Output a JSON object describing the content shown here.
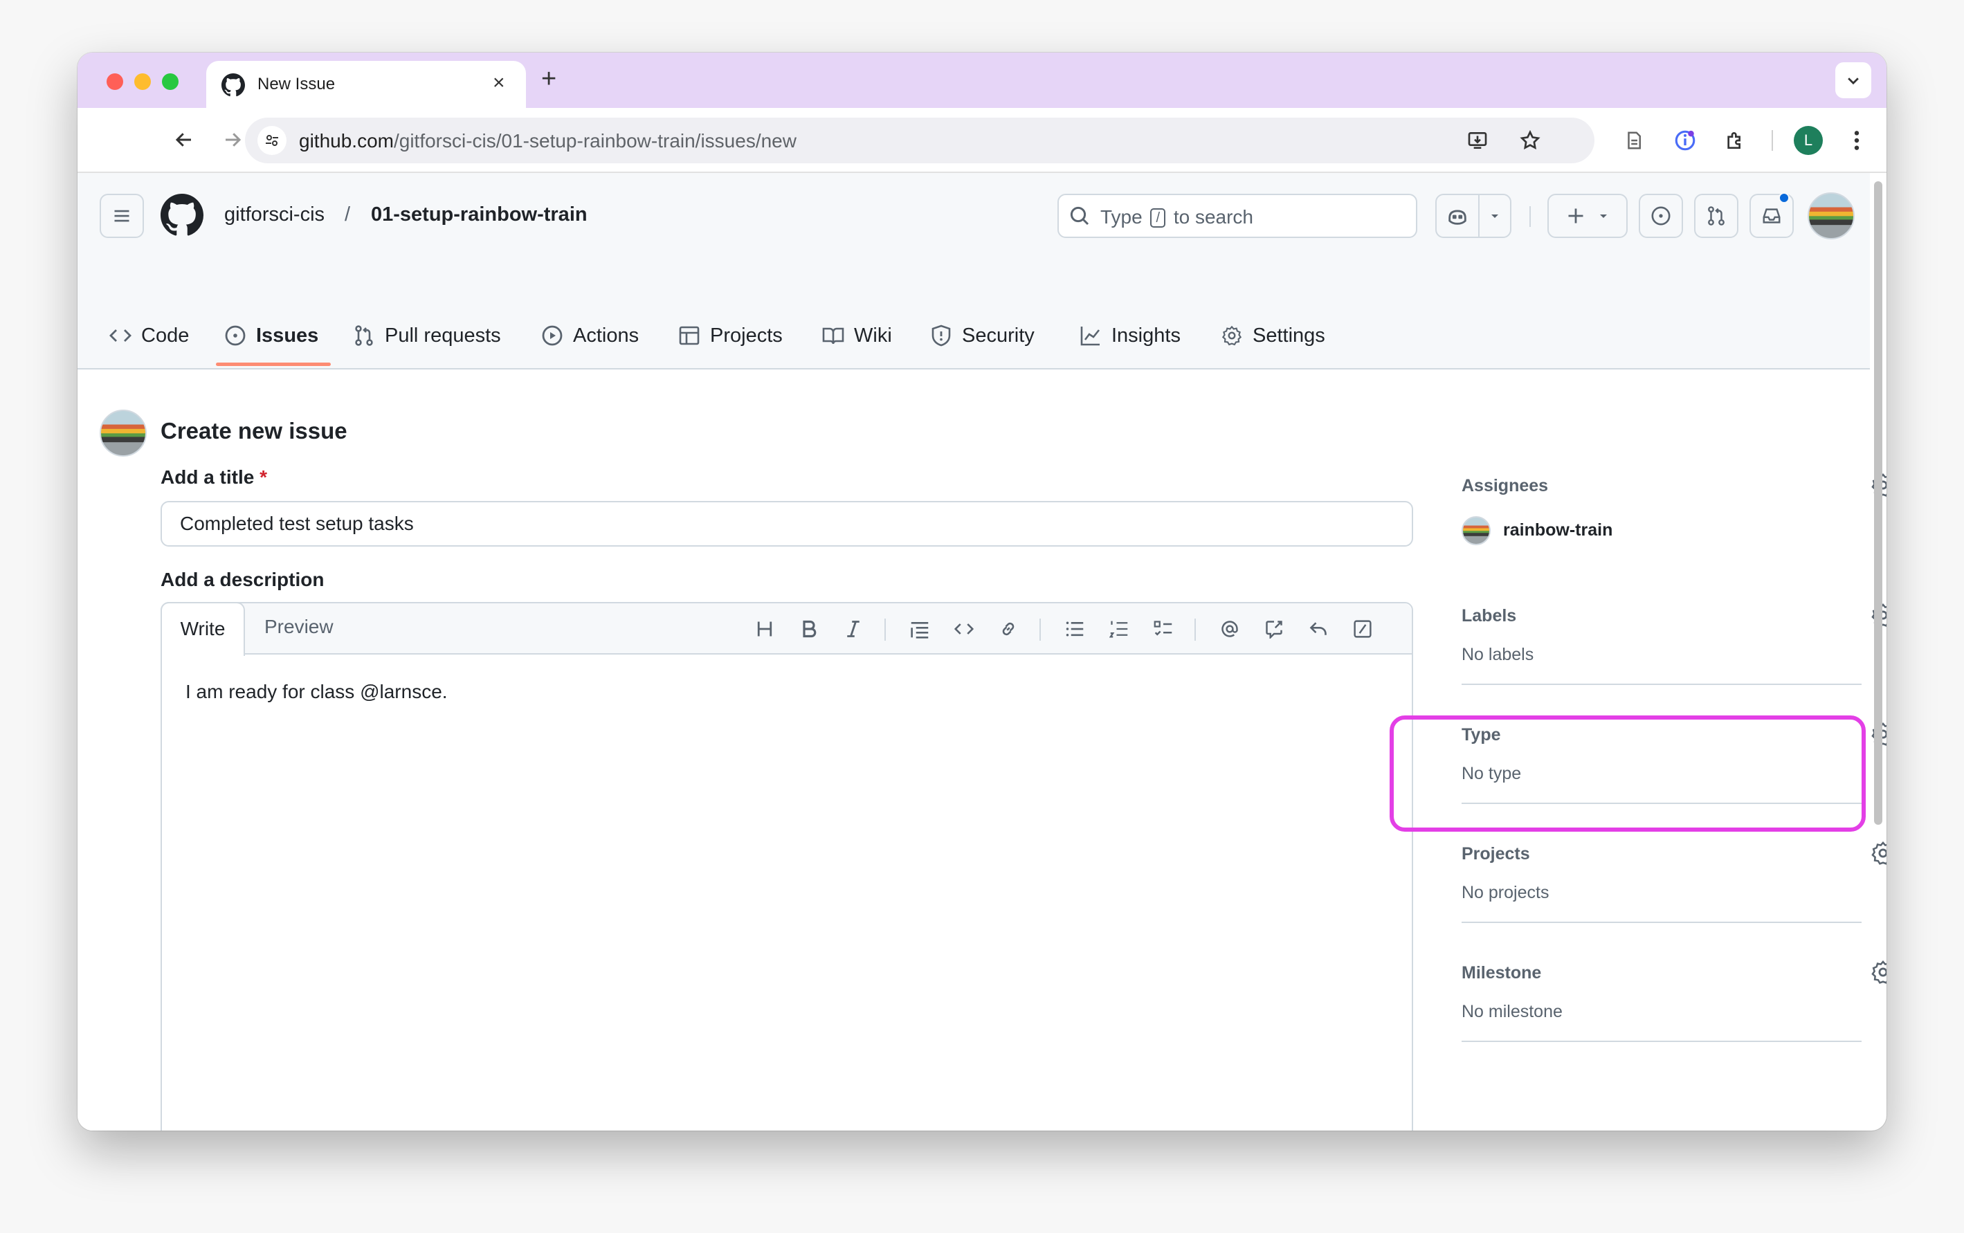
{
  "browser": {
    "tab_title": "New Issue",
    "new_tab_symbol": "+",
    "close_symbol": "×",
    "url_host": "github.com",
    "url_path": "/gitforsci-cis/01-setup-rainbow-train/issues/new",
    "profile_initial": "L"
  },
  "header": {
    "owner": "gitforsci-cis",
    "separator": "/",
    "repo": "01-setup-rainbow-train",
    "search_prefix": "Type",
    "search_key": "/",
    "search_suffix": "to search"
  },
  "repo_nav": [
    {
      "label": "Code",
      "icon": "code-icon"
    },
    {
      "label": "Issues",
      "icon": "issue-opened-icon",
      "active": true
    },
    {
      "label": "Pull requests",
      "icon": "git-pull-request-icon"
    },
    {
      "label": "Actions",
      "icon": "play-icon"
    },
    {
      "label": "Projects",
      "icon": "table-icon"
    },
    {
      "label": "Wiki",
      "icon": "book-icon"
    },
    {
      "label": "Security",
      "icon": "shield-icon"
    },
    {
      "label": "Insights",
      "icon": "graph-icon"
    },
    {
      "label": "Settings",
      "icon": "gear-icon"
    }
  ],
  "form": {
    "page_title": "Create new issue",
    "title_label": "Add a title",
    "required_mark": "*",
    "title_value": "Completed test setup tasks",
    "description_label": "Add a description",
    "write_tab": "Write",
    "preview_tab": "Preview",
    "description_value": "I am ready for class @larnsce."
  },
  "sidebar": {
    "assignees": {
      "title": "Assignees",
      "value": "rainbow-train"
    },
    "labels": {
      "title": "Labels",
      "value": "No labels"
    },
    "type": {
      "title": "Type",
      "value": "No type"
    },
    "projects": {
      "title": "Projects",
      "value": "No projects"
    },
    "milestone": {
      "title": "Milestone",
      "value": "No milestone"
    }
  },
  "colors": {
    "tab_strip": "#e6d5f7",
    "highlight": "#e33fe6",
    "active_underline": "#fd8c73",
    "required": "#d1242f"
  }
}
